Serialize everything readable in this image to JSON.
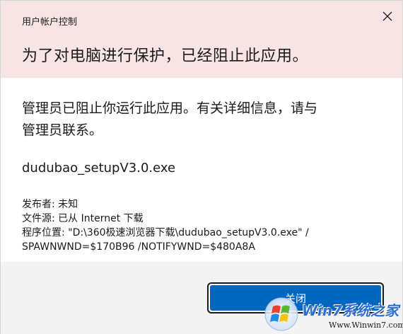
{
  "dialog": {
    "app_title": "用户帐户控制",
    "headline": "为了对电脑进行保护，已经阻止此应用。",
    "message": "管理员已阻止你运行此应用。有关详细信息，请与管理员联系。",
    "app_name": "dudubao_setupV3.0.exe",
    "details": {
      "publisher": "发布者: 未知",
      "file_source": "文件源: 已从 Internet 下载",
      "program_location": "程序位置: \"D:\\360极速浏览器下载\\dudubao_setupV3.0.exe\" /",
      "program_args": "SPAWNWND=$170B96 /NOTIFYWND=$480A8A"
    },
    "close_button_label": "关闭"
  },
  "icons": {
    "title_close": "close-icon",
    "watermark_logo": "windows-logo-icon"
  },
  "watermark": {
    "brand": "Win7系统之家",
    "url": "Www.Winwin7.com"
  },
  "colors": {
    "header_bg": "#f9e4e5",
    "accent": "#0067c0",
    "footer_bg": "#f3f3f3"
  }
}
